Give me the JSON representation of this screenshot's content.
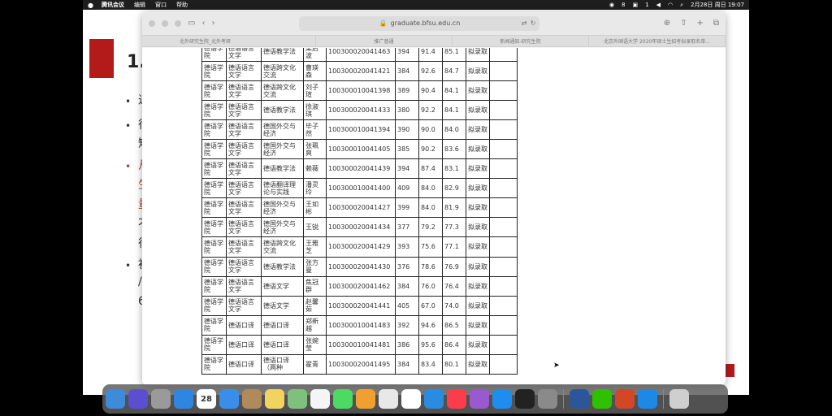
{
  "menubar": {
    "app_name": "腾讯会议",
    "items": [
      "编辑",
      "窗口",
      "帮助"
    ],
    "status_count": "8",
    "status_count2": "1",
    "datetime": "2月28日 周日 19:07"
  },
  "slide": {
    "title": "1.",
    "fragments": [
      "近",
      "很",
      "短",
      "从",
      "生",
      "量",
      "不",
      "很",
      "被",
      "/",
      "6"
    ]
  },
  "safari": {
    "url": "graduate.bfsu.edu.cn",
    "tabs": [
      "北外研究生院_北外考研",
      "推广普通",
      "新闻通知-研究生院",
      "北京外国语大学 2020年硕士生招考拟录取名单..."
    ]
  },
  "table": {
    "rows": [
      [
        "德语学院",
        "德语语言文学",
        "德语教学法",
        "梁启波",
        "100300020041463",
        "394",
        "91.4",
        "85.1",
        "拟录取",
        ""
      ],
      [
        "德语学院",
        "德语语言文学",
        "德语跨文化交流",
        "曹瑛森",
        "100300020041421",
        "384",
        "92.6",
        "84.7",
        "拟录取",
        ""
      ],
      [
        "德语学院",
        "德语语言文学",
        "德语跨文化交流",
        "刘子瑄",
        "100300010041398",
        "389",
        "90.4",
        "84.1",
        "拟录取",
        ""
      ],
      [
        "德语学院",
        "德语语言文学",
        "德语教学法",
        "徐淑琪",
        "100300020041433",
        "380",
        "92.2",
        "84.1",
        "拟录取",
        ""
      ],
      [
        "德语学院",
        "德语语言文学",
        "德国外交与经济",
        "毕子然",
        "100300010041394",
        "390",
        "90.0",
        "84.0",
        "拟录取",
        ""
      ],
      [
        "德语学院",
        "德语语言文学",
        "德国外交与经济",
        "张珮爽",
        "100300010041405",
        "385",
        "90.2",
        "83.6",
        "拟录取",
        ""
      ],
      [
        "德语学院",
        "德语语言文学",
        "德语教学法",
        "赖薇",
        "100300020041439",
        "394",
        "87.4",
        "83.1",
        "拟录取",
        ""
      ],
      [
        "德语学院",
        "德语语言文学",
        "德语翻译理论与实践",
        "潘灵玲",
        "100300010041400",
        "409",
        "84.0",
        "82.9",
        "拟录取",
        ""
      ],
      [
        "德语学院",
        "德语语言文学",
        "德国外交与经济",
        "王如彬",
        "100300020041427",
        "399",
        "84.0",
        "81.9",
        "拟录取",
        ""
      ],
      [
        "德语学院",
        "德语语言文学",
        "德国外交与经济",
        "王锐",
        "100300020041434",
        "377",
        "79.2",
        "77.3",
        "拟录取",
        ""
      ],
      [
        "德语学院",
        "德语语言文学",
        "德语跨文化交流",
        "王雅芝",
        "100300020041429",
        "393",
        "75.6",
        "77.1",
        "拟录取",
        ""
      ],
      [
        "德语学院",
        "德语语言文学",
        "德语教学法",
        "张方曼",
        "100300020041430",
        "376",
        "78.6",
        "76.9",
        "拟录取",
        ""
      ],
      [
        "德语学院",
        "德语语言文学",
        "德语文学",
        "焦冠群",
        "100300020041462",
        "384",
        "76.0",
        "76.4",
        "拟录取",
        ""
      ],
      [
        "德语学院",
        "德语语言文学",
        "德语文学",
        "赵馨茹",
        "100300020041441",
        "405",
        "67.0",
        "74.0",
        "拟录取",
        ""
      ],
      [
        "德语学院",
        "德语口译",
        "德语口译",
        "郑新越",
        "100300010041483",
        "392",
        "94.6",
        "86.5",
        "拟录取",
        ""
      ],
      [
        "德语学院",
        "德语口译",
        "德语口译",
        "张婉莹",
        "100300010041481",
        "386",
        "95.6",
        "86.4",
        "拟录取",
        ""
      ],
      [
        "德语学院",
        "德语口译",
        "德语口译（两种",
        "翟青",
        "100300020041495",
        "384",
        "83.4",
        "80.1",
        "拟录取",
        ""
      ]
    ]
  },
  "dock": {
    "calendar_day": "28"
  },
  "colors": {
    "accent_red": "#b31b1b",
    "menubar": "#1e1e1e"
  }
}
